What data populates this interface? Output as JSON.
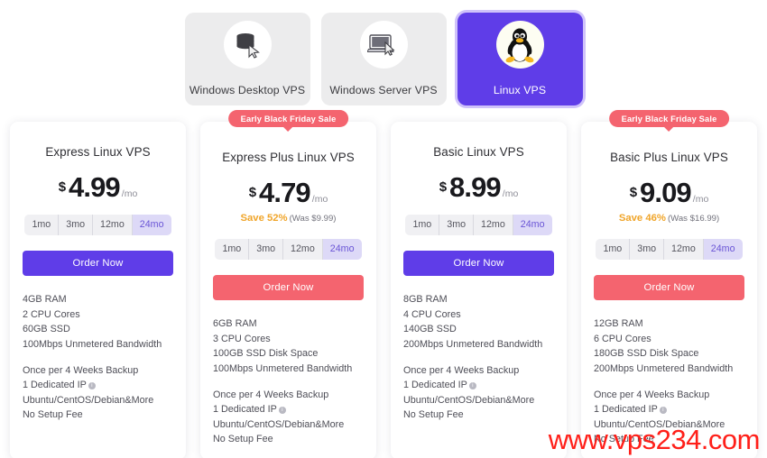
{
  "os_tabs": [
    {
      "label": "Windows Desktop VPS",
      "icon": "server-stack-icon",
      "active": false
    },
    {
      "label": "Windows Server VPS",
      "icon": "laptop-icon",
      "active": false
    },
    {
      "label": "Linux VPS",
      "icon": "linux-penguin-icon",
      "active": true
    }
  ],
  "colors": {
    "purple": "#5f3de8",
    "red": "#f4646f",
    "amber": "#f0a52a",
    "tab_inactive": "#ececed",
    "pill_selected_bg": "#ddd9f7",
    "watermark": "#ff1f19"
  },
  "badge_label": "Early Black Friday Sale",
  "plans": [
    {
      "name": "Express Linux VPS",
      "badge": false,
      "currency": "$",
      "amount": "4.99",
      "per": "/mo",
      "save_pct": "",
      "was": "",
      "durations": [
        "1mo",
        "3mo",
        "12mo",
        "24mo"
      ],
      "selected_duration": "24mo",
      "order_label": "Order Now",
      "order_color": "purple",
      "specs": [
        "4GB RAM",
        "2 CPU Cores",
        "60GB SSD",
        "100Mbps Unmetered Bandwidth"
      ],
      "extras": [
        "Once per 4 Weeks Backup",
        "1 Dedicated IP",
        "Ubuntu/CentOS/Debian&More",
        "No Setup Fee"
      ]
    },
    {
      "name": "Express Plus Linux VPS",
      "badge": true,
      "currency": "$",
      "amount": "4.79",
      "per": "/mo",
      "save_pct": "Save 52%",
      "was": "(Was $9.99)",
      "durations": [
        "1mo",
        "3mo",
        "12mo",
        "24mo"
      ],
      "selected_duration": "24mo",
      "order_label": "Order Now",
      "order_color": "red",
      "specs": [
        "6GB RAM",
        "3 CPU Cores",
        "100GB SSD Disk Space",
        "100Mbps Unmetered Bandwidth"
      ],
      "extras": [
        "Once per 4 Weeks Backup",
        "1 Dedicated IP",
        "Ubuntu/CentOS/Debian&More",
        "No Setup Fee"
      ]
    },
    {
      "name": "Basic Linux VPS",
      "badge": false,
      "currency": "$",
      "amount": "8.99",
      "per": "/mo",
      "save_pct": "",
      "was": "",
      "durations": [
        "1mo",
        "3mo",
        "12mo",
        "24mo"
      ],
      "selected_duration": "24mo",
      "order_label": "Order Now",
      "order_color": "purple",
      "specs": [
        "8GB RAM",
        "4 CPU Cores",
        "140GB SSD",
        "200Mbps Unmetered Bandwidth"
      ],
      "extras": [
        "Once per 4 Weeks Backup",
        "1 Dedicated IP",
        "Ubuntu/CentOS/Debian&More",
        "No Setup Fee"
      ]
    },
    {
      "name": "Basic Plus Linux VPS",
      "badge": true,
      "currency": "$",
      "amount": "9.09",
      "per": "/mo",
      "save_pct": "Save 46%",
      "was": "(Was $16.99)",
      "durations": [
        "1mo",
        "3mo",
        "12mo",
        "24mo"
      ],
      "selected_duration": "24mo",
      "order_label": "Order Now",
      "order_color": "red",
      "specs": [
        "12GB RAM",
        "6 CPU Cores",
        "180GB SSD Disk Space",
        "200Mbps Unmetered Bandwidth"
      ],
      "extras": [
        "Once per 4 Weeks Backup",
        "1 Dedicated IP",
        "Ubuntu/CentOS/Debian&More",
        "No Setup Fee"
      ]
    }
  ],
  "watermark": "www.vps234.com"
}
